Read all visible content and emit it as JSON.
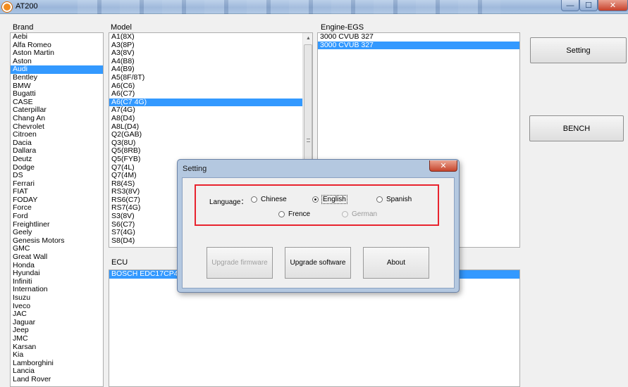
{
  "window": {
    "title": "AT200"
  },
  "labels": {
    "brand": "Brand",
    "model": "Model",
    "engine": "Engine-EGS",
    "ecu": "ECU"
  },
  "brands": [
    "Aebi",
    "Alfa Romeo",
    "Aston Martin",
    "Aston",
    "Audi",
    "Bentley",
    "BMW",
    "Bugatti",
    "CASE",
    "Caterpillar",
    "Chang An",
    "Chevrolet",
    "Citroen",
    "Dacia",
    "Dallara",
    "Deutz",
    "Dodge",
    "DS",
    "Ferrari",
    "FIAT",
    "FODAY",
    "Force",
    "Ford",
    "Freightliner",
    "Geely",
    "Genesis Motors",
    "GMC",
    "Great Wall",
    "Honda",
    "Hyundai",
    "Infiniti",
    "Internation",
    "Isuzu",
    "Iveco",
    "JAC",
    "Jaguar",
    "Jeep",
    "JMC",
    "Karsan",
    "Kia",
    "Lamborghini",
    "Lancia",
    "Land Rover"
  ],
  "brand_selected": "Audi",
  "models": [
    "A1(8X)",
    "A3(8P)",
    "A3(8V)",
    "A4(B8)",
    "A4(B9)",
    "A5(8F/8T)",
    "A6(C6)",
    "A6(C7)",
    "A6(C7 4G)",
    "A7(4G)",
    "A8(D4)",
    "A8L(D4)",
    "Q2(GAB)",
    "Q3(8U)",
    "Q5(8RB)",
    "Q5(FYB)",
    "Q7(4L)",
    "Q7(4M)",
    "R8(4S)",
    "RS3(8V)",
    "RS6(C7)",
    "RS7(4G)",
    "S3(8V)",
    "S6(C7)",
    "S7(4G)",
    "S8(D4)"
  ],
  "model_selected": "A6(C7 4G)",
  "engines": [
    "3000 CVUB 327",
    "3000 CVUB 327"
  ],
  "engine_selected_index": 1,
  "ecus": [
    "BOSCH EDC17CP44"
  ],
  "ecu_selected_index": 0,
  "buttons": {
    "setting": "Setting",
    "bench": "BENCH"
  },
  "dialog": {
    "title": "Setting",
    "close_glyph": "✕",
    "language_label": "Language：",
    "options": {
      "chinese": "Chinese",
      "english": "English",
      "spanish": "Spanish",
      "french": "Frence",
      "german": "German"
    },
    "selected_language": "english",
    "buttons": {
      "upgrade_firmware": "Upgrade firmware",
      "upgrade_software": "Upgrade software",
      "about": "About"
    }
  },
  "colors": {
    "selection": "#3399ff",
    "highlight_frame": "#e8232e"
  }
}
